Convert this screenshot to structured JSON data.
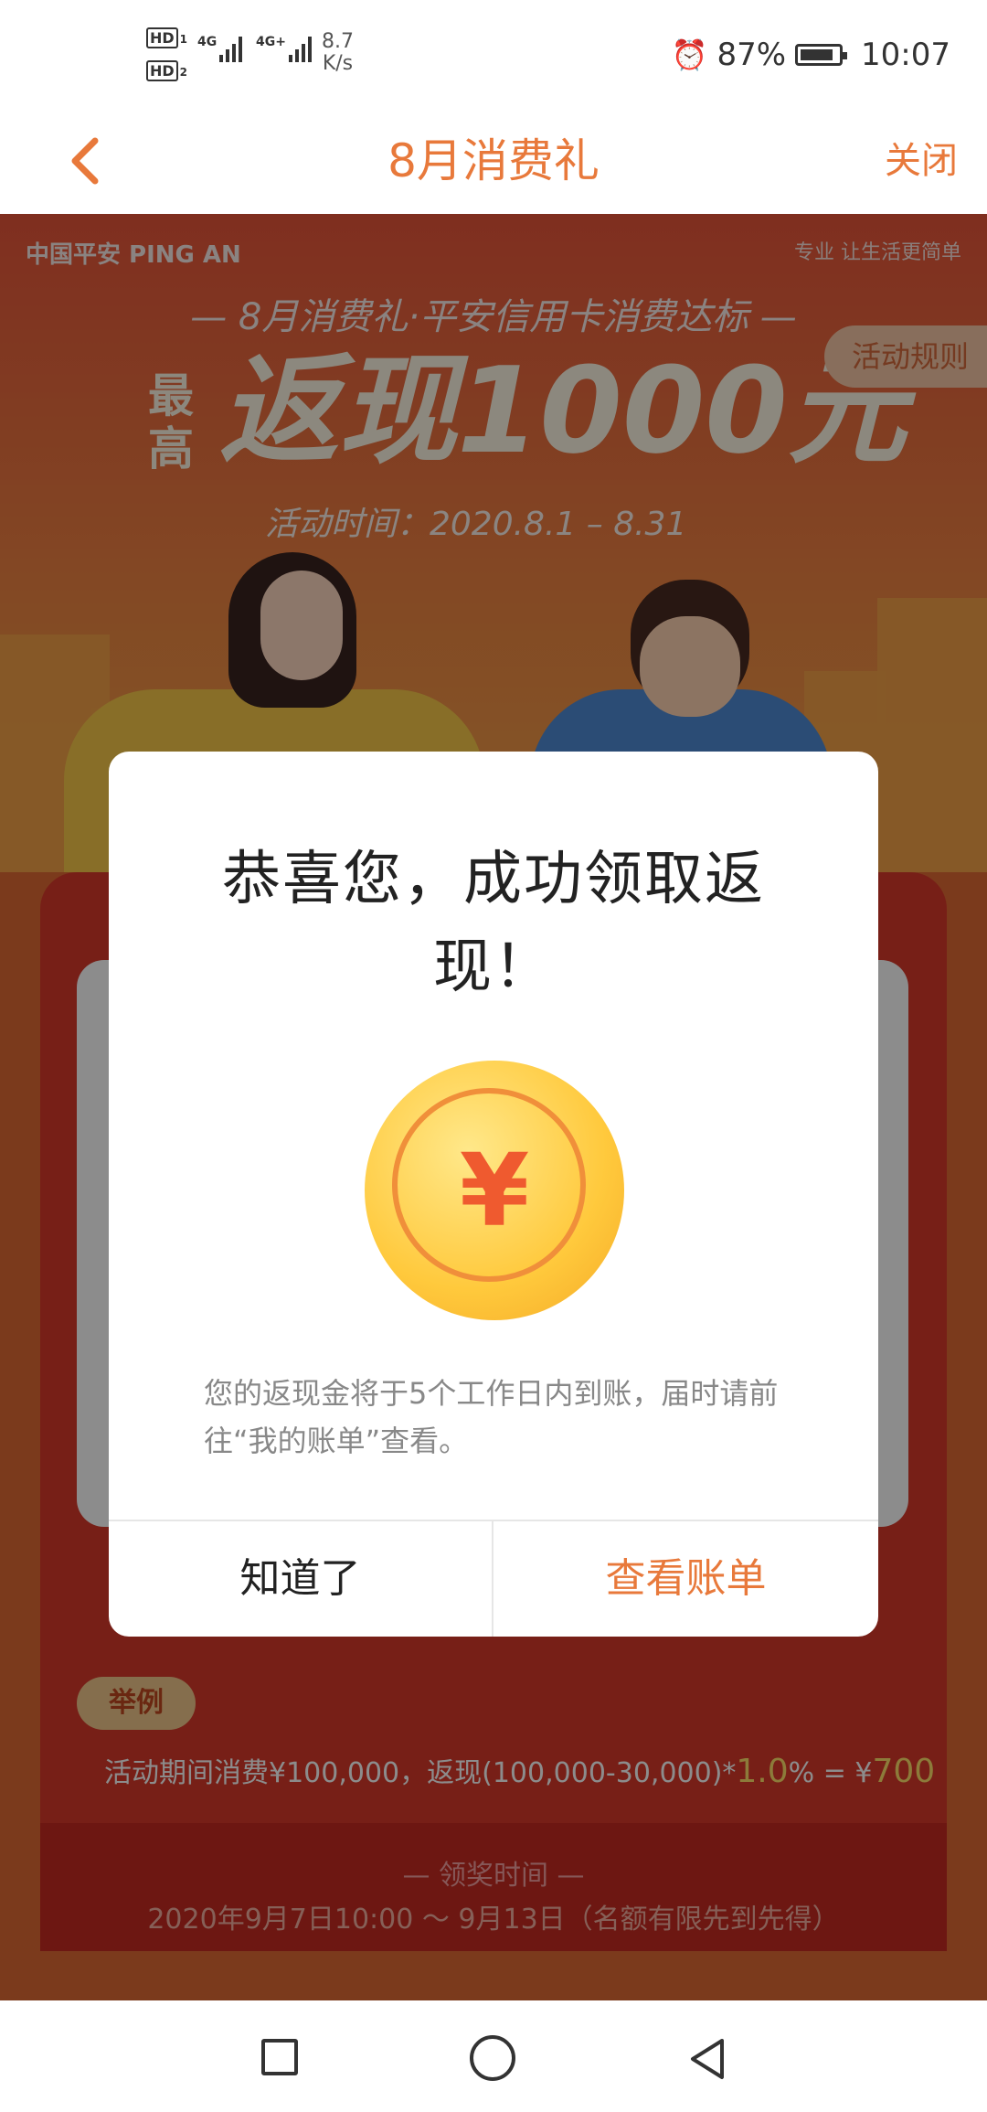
{
  "status_bar": {
    "hd1": "HD",
    "hd1_sub": "1",
    "hd2": "HD",
    "hd2_sub": "2",
    "net1": "4G",
    "net2": "4G+",
    "speed_value": "8.7",
    "speed_unit": "K/s",
    "battery_percent": "87%",
    "battery_level": 0.87,
    "time": "10:07"
  },
  "header": {
    "back_icon": "‹",
    "title": "8月消费礼",
    "close_label": "关闭"
  },
  "banner": {
    "brand": "中国平安 PING AN",
    "slogan": "专业 让生活更简单",
    "subtitle": "— 8月消费礼·平安信用卡消费达标 —",
    "prefix": "最高",
    "headline": "返现1000元",
    "period": "活动时间：2020.8.1 – 8.31",
    "rules_button": "活动规则"
  },
  "example": {
    "tag": "举例",
    "text_before": "活动期间消费¥100,000，返现(100,000-30,000)*",
    "rate": "1.0",
    "text_mid": "% = ¥",
    "amount": "700"
  },
  "claim": {
    "title": "— 领奖时间 —",
    "time": "2020年9月7日10:00 ～ 9月13日（名额有限先到先得）"
  },
  "dialog": {
    "title": "恭喜您，成功领取返现！",
    "coin_symbol": "¥",
    "message": "您的返现金将于5个工作日内到账，届时请前往“我的账单”查看。",
    "ok_button": "知道了",
    "bill_button": "查看账单"
  },
  "colors": {
    "accent": "#e8793b",
    "card_red": "#d93a2b",
    "coin_gold": "#ffc93c"
  }
}
